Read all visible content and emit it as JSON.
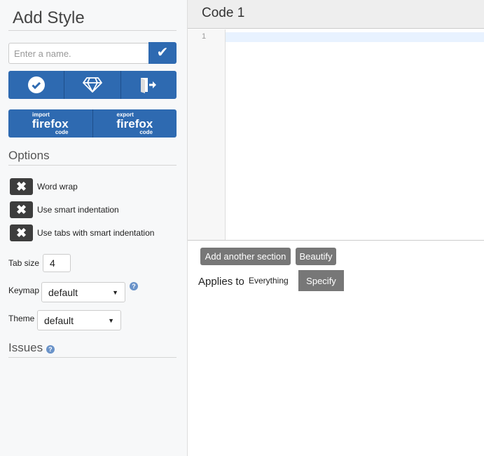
{
  "sidebar": {
    "title": "Add Style",
    "name_placeholder": "Enter a name.",
    "import_button": {
      "small": "import",
      "big": "firefox",
      "code": "code"
    },
    "export_button": {
      "small": "export",
      "big": "firefox",
      "code": "code"
    },
    "options_heading": "Options",
    "options": [
      {
        "label": "Word wrap",
        "checked": false
      },
      {
        "label": "Use smart indentation",
        "checked": false
      },
      {
        "label": "Use tabs with smart indentation",
        "checked": false
      }
    ],
    "tab_size_label": "Tab size",
    "tab_size": "4",
    "keymap_label": "Keymap",
    "keymap_value": "default",
    "theme_label": "Theme",
    "theme_value": "default",
    "issues_heading": "Issues",
    "help_glyph": "?"
  },
  "editor": {
    "title": "Code 1",
    "line_numbers": [
      "1"
    ],
    "add_section": "Add another section",
    "beautify": "Beautify",
    "applies_to_label": "Applies to",
    "applies_to_value": "Everything",
    "specify": "Specify"
  },
  "colors": {
    "accent": "#2e6ab1",
    "button_gray": "#777777",
    "toggle": "#3d3d3d"
  }
}
